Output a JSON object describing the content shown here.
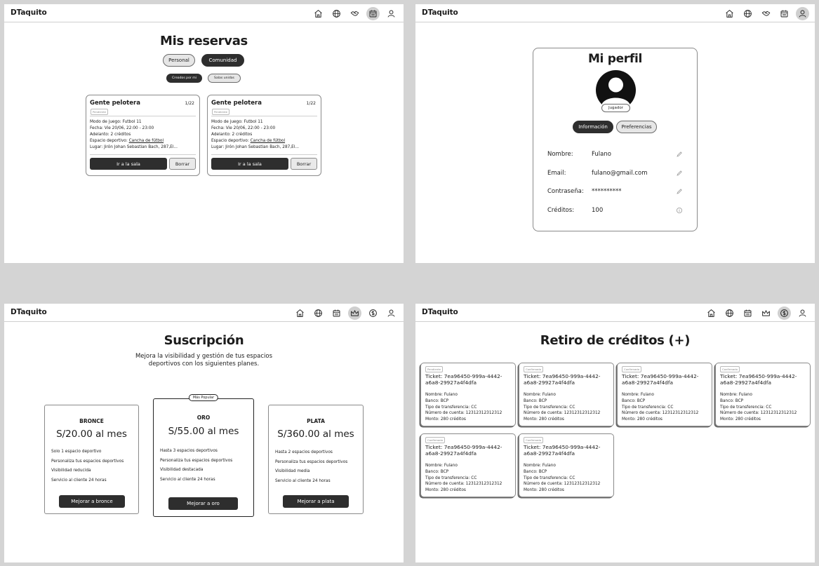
{
  "app_name": "DTaquito",
  "reservas": {
    "title": "Mis reservas",
    "tabs": [
      "Personal",
      "Comunidad"
    ],
    "subtabs": [
      "Creados por mi",
      "Salas unidas"
    ],
    "cards": [
      {
        "name": "Gente pelotera",
        "count": "1/22",
        "status": "Pendiente",
        "modo": "Modo de juego: Futbol 11",
        "fecha": "Fecha: Vie 20/06, 22:00 - 23:00",
        "adelanto": "Adelanto: 2 créditos",
        "espacio_label": "Espacio deportivo: ",
        "espacio_value": "Cancha de fútbol",
        "lugar": "Lugar: Jirón Johan Sebastian Bach, 287,El...",
        "go_label": "Ir a la sala",
        "delete_label": "Borrar"
      },
      {
        "name": "Gente pelotera",
        "count": "1/22",
        "status": "Pendiente",
        "modo": "Modo de juego: Futbol 11",
        "fecha": "Fecha: Vie 20/06, 22:00 - 23:00",
        "adelanto": "Adelanto: 2 créditos",
        "espacio_label": "Espacio deportivo: ",
        "espacio_value": "Cancha de fútbol",
        "lugar": "Lugar: Jirón Johan Sebastian Bach, 287,El...",
        "go_label": "Ir a la sala",
        "delete_label": "Borrar"
      }
    ]
  },
  "perfil": {
    "title": "Mi perfil",
    "role": "Jugador",
    "tabs": [
      "Información",
      "Preferencias"
    ],
    "fields": [
      {
        "label": "Nombre:",
        "value": "Fulano",
        "icon": "pencil-icon"
      },
      {
        "label": "Email:",
        "value": "fulano@gmail.com",
        "icon": "pencil-icon"
      },
      {
        "label": "Contraseña:",
        "value": "**********",
        "icon": "pencil-icon"
      },
      {
        "label": "Créditos:",
        "value": "100",
        "icon": "info-icon"
      }
    ]
  },
  "suscripcion": {
    "title": "Suscripción",
    "subtitle_1": "Mejora la visibilidad y gestión de tus espacios",
    "subtitle_2": "deportivos con los siguientes planes.",
    "popular_label": "Más Popular",
    "plans": [
      {
        "name": "BRONCE",
        "price": "S/20.00 al mes",
        "features": [
          "Solo 1 espacio deportivo",
          "Personaliza tus espacios deportivos",
          "Visibilidad reducida",
          "Servicio al cliente 24 horas"
        ],
        "button": "Mejorar a bronce"
      },
      {
        "name": "ORO",
        "price": "S/55.00 al mes",
        "features": [
          "Hasta 3 espacios deportivos",
          "Personaliza tus espacios deportivos",
          "Visibilidad destacada",
          "Servicio al cliente 24 horas"
        ],
        "button": "Mejorar a oro"
      },
      {
        "name": "PLATA",
        "price": "S/360.00 al mes",
        "features": [
          "Hasta 2 espacios deportivos",
          "Personaliza tus espacios deportivos",
          "Visibilidad media",
          "Servicio al cliente 24 horas"
        ],
        "button": "Mejorar a plata"
      }
    ]
  },
  "retiro": {
    "title": "Retiro de créditos (+)",
    "tickets": [
      {
        "status": "Pendiente",
        "ticket_1": "Ticket: 7ea96450-999a-4442-",
        "ticket_2": "a6a8-29927a4f4dfa",
        "nombre": "Nombre: Fulano",
        "banco": "Banco: BCP",
        "tipo": "Tipo de transferencia: CC",
        "cuenta": "Número de cuenta: 12312312312312",
        "monto": "Monto: 280 créditos"
      },
      {
        "status": "Confirmado",
        "ticket_1": "Ticket: 7ea96450-999a-4442-",
        "ticket_2": "a6a8-29927a4f4dfa",
        "nombre": "Nombre: Fulano",
        "banco": "Banco: BCP",
        "tipo": "Tipo de transferencia: CC",
        "cuenta": "Número de cuenta: 12312312312312",
        "monto": "Monto: 280 créditos"
      },
      {
        "status": "Confirmado",
        "ticket_1": "Ticket: 7ea96450-999a-4442-",
        "ticket_2": "a6a8-29927a4f4dfa",
        "nombre": "Nombre: Fulano",
        "banco": "Banco: BCP",
        "tipo": "Tipo de transferencia: CC",
        "cuenta": "Número de cuenta: 12312312312312",
        "monto": "Monto: 280 créditos"
      },
      {
        "status": "Confirmado",
        "ticket_1": "Ticket: 7ea96450-999a-4442-",
        "ticket_2": "a6a8-29927a4f4dfa",
        "nombre": "Nombre: Fulano",
        "banco": "Banco: BCP",
        "tipo": "Tipo de transferencia: CC",
        "cuenta": "Número de cuenta: 12312312312312",
        "monto": "Monto: 280 créditos"
      },
      {
        "status": "Confirmado",
        "ticket_1": "Ticket: 7ea96450-999a-4442-",
        "ticket_2": "a6a8-29927a4f4dfa",
        "nombre": "Nombre: Fulano",
        "banco": "Banco: BCP",
        "tipo": "Tipo de transferencia: CC",
        "cuenta": "Número de cuenta: 12312312312312",
        "monto": "Monto: 280 créditos"
      },
      {
        "status": "Confirmado",
        "ticket_1": "Ticket: 7ea96450-999a-4442-",
        "ticket_2": "a6a8-29927a4f4dfa",
        "nombre": "Nombre: Fulano",
        "banco": "Banco: BCP",
        "tipo": "Tipo de transferencia: CC",
        "cuenta": "Número de cuenta: 12312312312312",
        "monto": "Monto: 280 créditos"
      }
    ]
  },
  "nav_icons": {
    "s1": [
      "home-icon",
      "globe-icon",
      "handshake-icon",
      "calendar-icon",
      "user-icon"
    ],
    "s2": [
      "home-icon",
      "globe-icon",
      "handshake-icon",
      "calendar-icon",
      "user-icon"
    ],
    "s3": [
      "home-icon",
      "globe-icon",
      "calendar-icon",
      "crown-icon",
      "dollar-icon",
      "user-icon"
    ],
    "s4": [
      "home-icon",
      "globe-icon",
      "calendar-icon",
      "crown-icon",
      "dollar-icon",
      "user-icon"
    ]
  },
  "active_nav": {
    "s1": "calendar-icon",
    "s2": "user-icon",
    "s3": "crown-icon",
    "s4": "dollar-icon"
  },
  "colors": {
    "dark": "#2e2e2e",
    "light": "#e6e6e6",
    "background": "#d4d4d4",
    "border": "#8a8a8a"
  }
}
